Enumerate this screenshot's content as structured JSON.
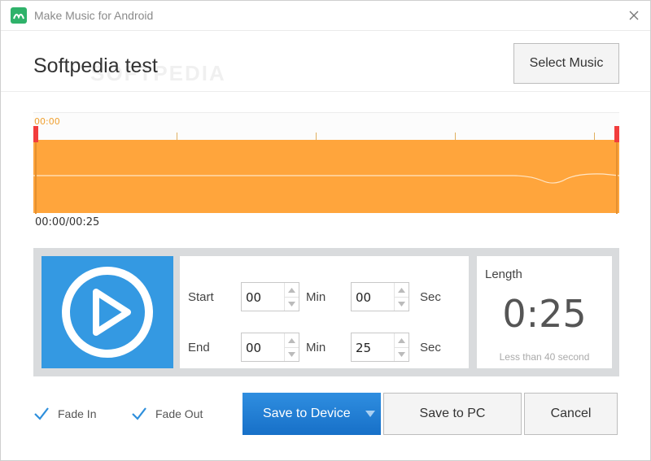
{
  "window": {
    "title": "Make Music for Android"
  },
  "header": {
    "project_title": "Softpedia test",
    "watermark": "SOFTPEDIA",
    "select_music_label": "Select Music"
  },
  "waveform": {
    "ruler_start": "00:00",
    "time_readout": "00:00/00:25",
    "progress": {
      "start_fraction": 0.0,
      "end_fraction": 1.0
    }
  },
  "trim": {
    "start_label": "Start",
    "end_label": "End",
    "min_label": "Min",
    "sec_label": "Sec",
    "start_min": "00",
    "start_sec": "00",
    "end_min": "00",
    "end_sec": "25"
  },
  "length": {
    "label": "Length",
    "value": "0:25",
    "hint": "Less than 40 second"
  },
  "options": {
    "fade_in_label": "Fade In",
    "fade_out_label": "Fade Out",
    "fade_in_checked": true,
    "fade_out_checked": true
  },
  "actions": {
    "save_to_device_label": "Save to Device",
    "save_to_pc_label": "Save to PC",
    "cancel_label": "Cancel"
  },
  "colors": {
    "accent": "#3499e2",
    "waveform": "#ffa53c",
    "marker": "#f23d3d",
    "checkbox": "#2e8fdc"
  },
  "icons": {
    "app": "music-app-icon",
    "close": "close-icon",
    "play": "play-icon",
    "dropdown": "dropdown-arrow-icon",
    "check": "checkmark-icon"
  }
}
